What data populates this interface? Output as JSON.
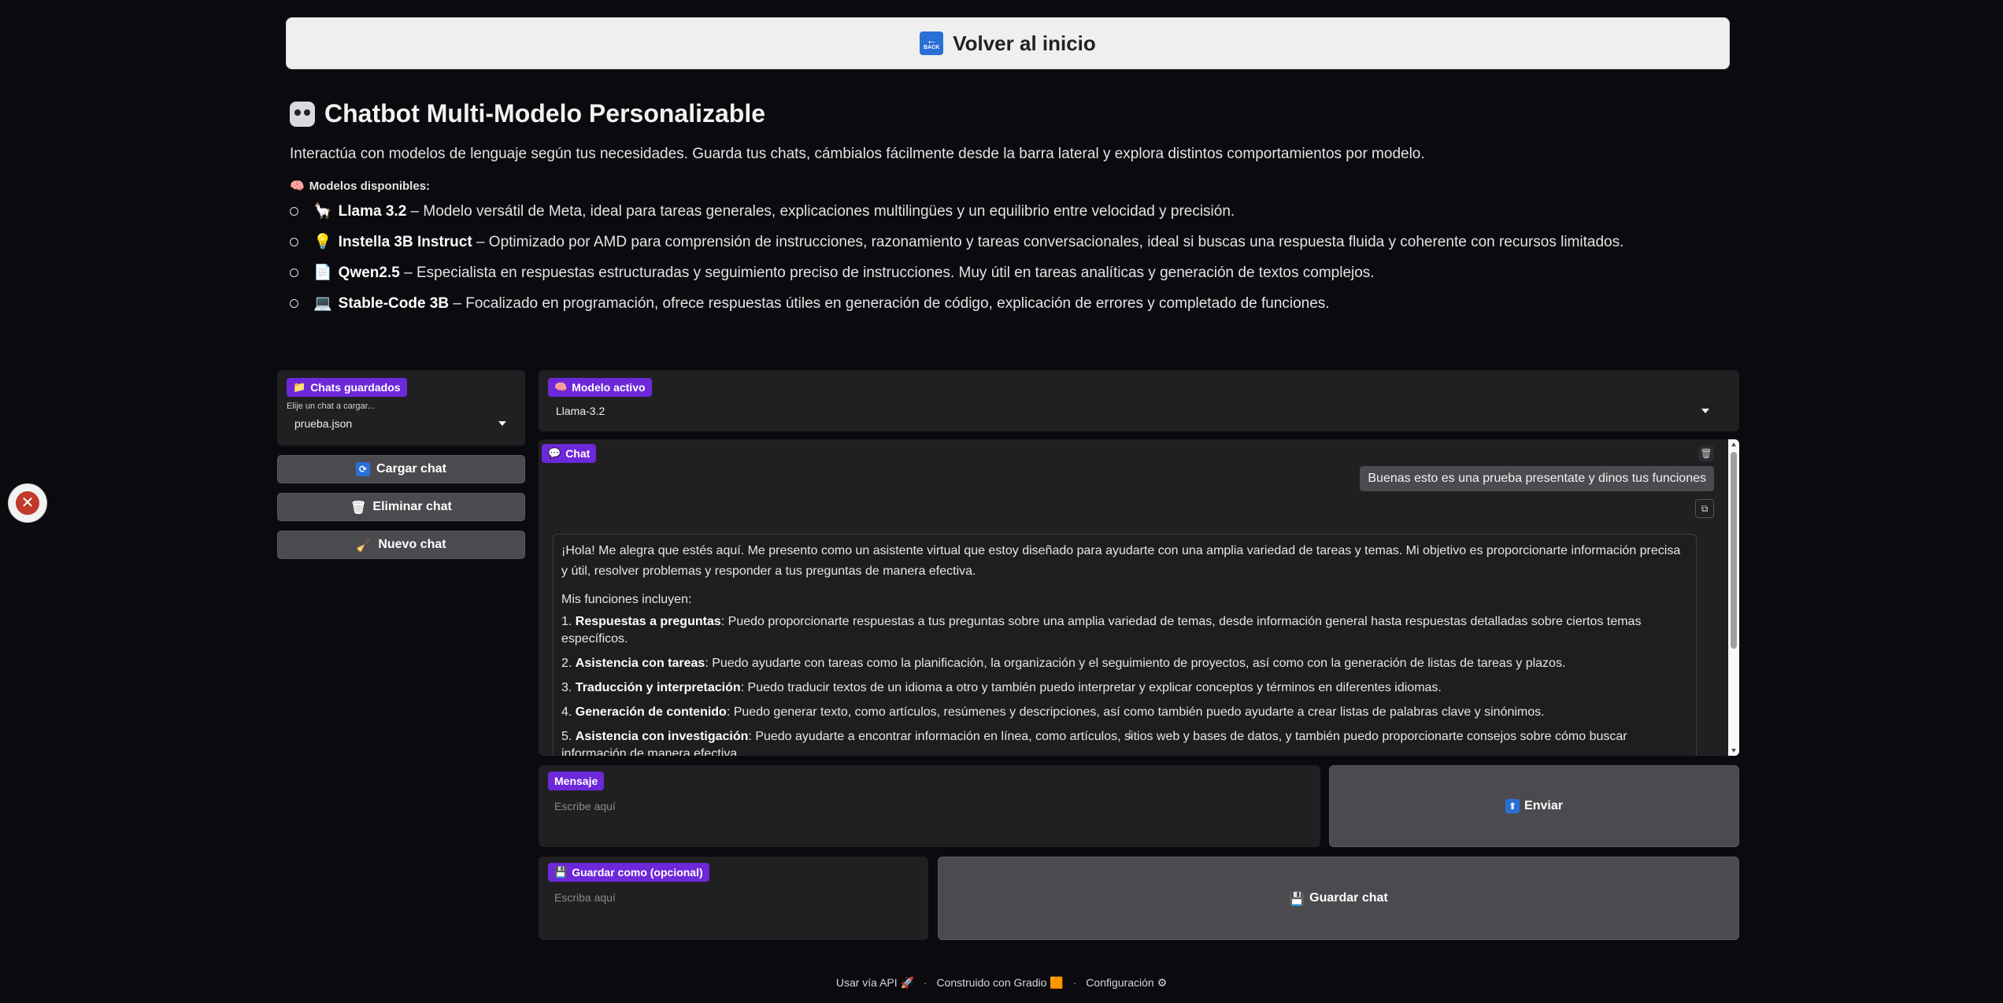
{
  "back_button": {
    "label": "Volver al inicio",
    "icon": "back-arrow-icon",
    "icon_text": "BACK"
  },
  "header": {
    "title": "Chatbot Multi-Modelo Personalizable",
    "description": "Interactúa con modelos de lenguaje según tus necesidades. Guarda tus chats, cámbialos fácilmente desde la barra lateral y explora distintos comportamientos por modelo.",
    "models_heading": "Modelos disponibles:",
    "models": [
      {
        "emoji": "🦙",
        "name": "Llama 3.2",
        "desc": " – Modelo versátil de Meta, ideal para tareas generales, explicaciones multilingües y un equilibrio entre velocidad y precisión."
      },
      {
        "emoji": "💡",
        "name": "Instella 3B Instruct",
        "desc": " – Optimizado por AMD para comprensión de instrucciones, razonamiento y tareas conversacionales, ideal si buscas una respuesta fluida y coherente con recursos limitados."
      },
      {
        "emoji": "📄",
        "name": "Qwen2.5",
        "desc": " – Especialista en respuestas estructuradas y seguimiento preciso de instrucciones. Muy útil en tareas analíticas y generación de textos complejos."
      },
      {
        "emoji": "💻",
        "name": "Stable-Code 3B",
        "desc": " – Focalizado en programación, ofrece respuestas útiles en generación de código, explicación de errores y completado de funciones."
      }
    ]
  },
  "sidebar": {
    "saved_label": "Chats guardados",
    "saved_hint": "Elije un chat a cargar...",
    "saved_value": "prueba.json",
    "load_label": "Cargar chat",
    "delete_label": "Eliminar chat",
    "new_label": "Nuevo chat"
  },
  "model": {
    "label": "Modelo activo",
    "value": "Llama-3.2"
  },
  "chat": {
    "label": "Chat",
    "user_message": "Buenas esto es una prueba presentate y dinos tus funciones",
    "bot_intro": "¡Hola! Me alegra que estés aquí. Me presento como un asistente virtual que estoy diseñado para ayudarte con una amplia variedad de tareas y temas. Mi objetivo es proporcionarte información precisa y útil, resolver problemas y responder a tus preguntas de manera efectiva.",
    "bot_functions_heading": "Mis funciones incluyen:",
    "functions": [
      {
        "num": "1. ",
        "title": "Respuestas a preguntas",
        "text": ": Puedo proporcionarte respuestas a tus preguntas sobre una amplia variedad de temas, desde información general hasta respuestas detalladas sobre ciertos temas específicos."
      },
      {
        "num": "2. ",
        "title": "Asistencia con tareas",
        "text": ": Puedo ayudarte con tareas como la planificación, la organización y el seguimiento de proyectos, así como con la generación de listas de tareas y plazos."
      },
      {
        "num": "3. ",
        "title": "Traducción y interpretación",
        "text": ": Puedo traducir textos de un idioma a otro y también puedo interpretar y explicar conceptos y términos en diferentes idiomas."
      },
      {
        "num": "4. ",
        "title": "Generación de contenido",
        "text": ": Puedo generar texto, como artículos, resúmenes y descripciones, así como también puedo ayudarte a crear listas de palabras clave y sinónimos."
      },
      {
        "num": "5. ",
        "title": "Asistencia con investigación",
        "text": ": Puedo ayudarte a encontrar información en línea, como artículos, sitios web y bases de datos, y también puedo proporcionarte consejos sobre cómo buscar información de manera efectiva."
      }
    ]
  },
  "message": {
    "label": "Mensaje",
    "placeholder": "Escribe aquí"
  },
  "send_label": "Enviar",
  "save_as": {
    "label": "Guardar como (opcional)",
    "placeholder": "Escriba aquí"
  },
  "save_label": "Guardar chat",
  "footer": {
    "api": "Usar vía API",
    "built": "Construido con Gradio",
    "settings": "Configuración"
  },
  "colors": {
    "accent": "#6d28d9",
    "background": "#0b0b0f",
    "panel": "#202022",
    "button": "#4b4b4f"
  }
}
